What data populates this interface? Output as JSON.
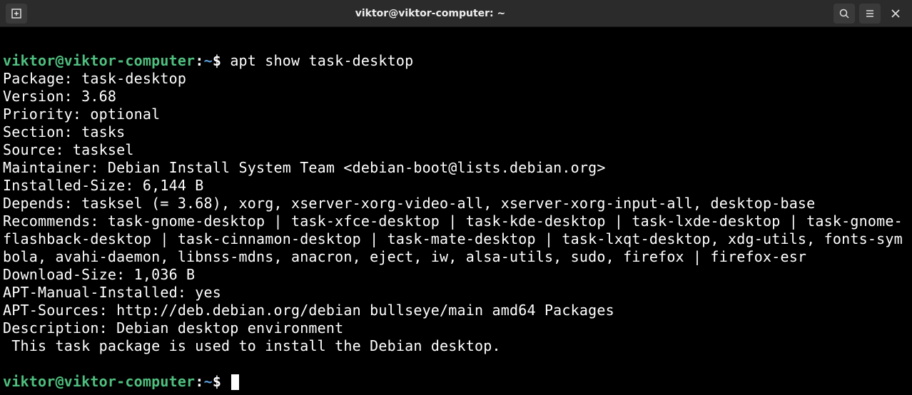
{
  "titlebar": {
    "title": "viktor@viktor-computer: ~"
  },
  "prompt": {
    "user_host": "viktor@viktor-computer",
    "colon": ":",
    "path": "~",
    "dollar": "$"
  },
  "command": "apt show task-desktop",
  "output": {
    "package": "Package: task-desktop",
    "version": "Version: 3.68",
    "priority": "Priority: optional",
    "section": "Section: tasks",
    "source": "Source: tasksel",
    "maintainer": "Maintainer: Debian Install System Team <debian-boot@lists.debian.org>",
    "installed_size": "Installed-Size: 6,144 B",
    "depends": "Depends: tasksel (= 3.68), xorg, xserver-xorg-video-all, xserver-xorg-input-all, desktop-base",
    "recommends": "Recommends: task-gnome-desktop | task-xfce-desktop | task-kde-desktop | task-lxde-desktop | task-gnome-flashback-desktop | task-cinnamon-desktop | task-mate-desktop | task-lxqt-desktop, xdg-utils, fonts-symbola, avahi-daemon, libnss-mdns, anacron, eject, iw, alsa-utils, sudo, firefox | firefox-esr",
    "download_size": "Download-Size: 1,036 B",
    "apt_manual": "APT-Manual-Installed: yes",
    "apt_sources": "APT-Sources: http://deb.debian.org/debian bullseye/main amd64 Packages",
    "description": "Description: Debian desktop environment",
    "desc_body": " This task package is used to install the Debian desktop."
  }
}
